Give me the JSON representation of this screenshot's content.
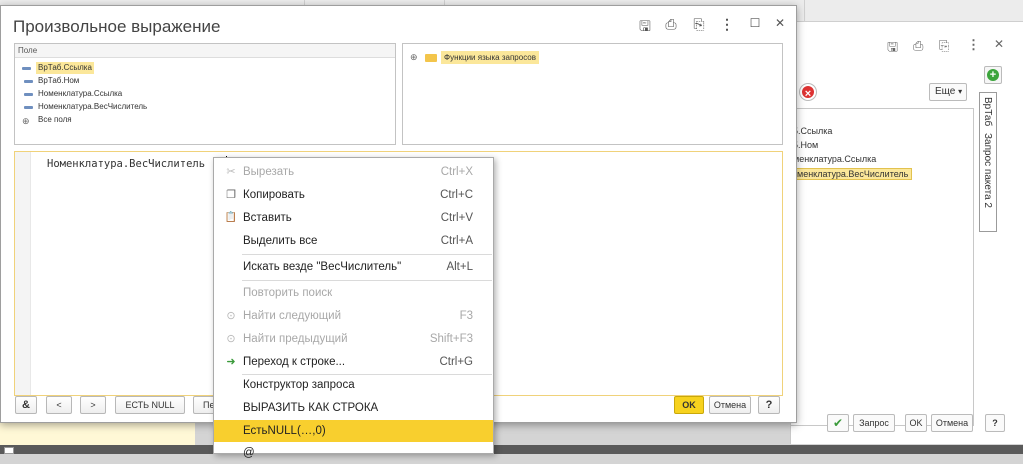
{
  "dialog": {
    "title": "Произвольное выражение",
    "fields_header": "Поле",
    "fields": [
      {
        "label": "ВрТаб.Ссылка",
        "selected": true
      },
      {
        "label": "ВрТаб.Ном",
        "selected": false
      },
      {
        "label": "Номенклатура.Ссылка",
        "selected": false
      },
      {
        "label": "Номенклатура.ВесЧислитель",
        "selected": false
      }
    ],
    "all_fields": "Все поля",
    "functions_label": "Функции языка запросов",
    "editor_text": "Номенклатура.ВесЧислитель",
    "buttons": {
      "amp": "&",
      "prev": "<",
      "next": ">",
      "isnull": "ЕСТЬ NULL",
      "more_partial": "Пе",
      "ok": "OK",
      "cancel": "Отмена",
      "help": "?"
    }
  },
  "context_menu": {
    "items": [
      {
        "icon": "cut-icon",
        "glyph": "✂",
        "label": "Вырезать",
        "shortcut": "Ctrl+X",
        "disabled": true,
        "highlighted": false
      },
      {
        "icon": "copy-icon",
        "glyph": "❐",
        "label": "Копировать",
        "shortcut": "Ctrl+C",
        "disabled": false,
        "highlighted": false
      },
      {
        "icon": "paste-icon",
        "glyph": "📋",
        "label": "Вставить",
        "shortcut": "Ctrl+V",
        "disabled": false,
        "highlighted": false
      },
      {
        "icon": "",
        "glyph": "",
        "label": "Выделить все",
        "shortcut": "Ctrl+A",
        "disabled": false,
        "highlighted": false
      },
      {
        "icon": "",
        "glyph": "",
        "label": "Искать везде \"ВесЧислитель\"",
        "shortcut": "Alt+L",
        "disabled": false,
        "highlighted": false
      },
      {
        "icon": "",
        "glyph": "",
        "label": "Повторить поиск",
        "shortcut": "",
        "disabled": true,
        "highlighted": false
      },
      {
        "icon": "find-next-icon",
        "glyph": "⊙",
        "label": "Найти следующий",
        "shortcut": "F3",
        "disabled": true,
        "highlighted": false
      },
      {
        "icon": "find-prev-icon",
        "glyph": "⊙",
        "label": "Найти предыдущий",
        "shortcut": "Shift+F3",
        "disabled": true,
        "highlighted": false
      },
      {
        "icon": "goto-line-icon",
        "glyph": "➜",
        "label": "Переход к строке...",
        "shortcut": "Ctrl+G",
        "disabled": false,
        "highlighted": false
      },
      {
        "icon": "",
        "glyph": "",
        "label": "Конструктор запроса",
        "shortcut": "",
        "disabled": false,
        "highlighted": false
      },
      {
        "icon": "",
        "glyph": "",
        "label": "ВЫРАЗИТЬ КАК СТРОКА",
        "shortcut": "",
        "disabled": false,
        "highlighted": false
      },
      {
        "icon": "",
        "glyph": "",
        "label": "ЕстьNULL(…,0)",
        "shortcut": "",
        "disabled": false,
        "highlighted": true
      },
      {
        "icon": "",
        "glyph": "",
        "label": "@",
        "shortcut": "",
        "disabled": false,
        "highlighted": false
      }
    ]
  },
  "background_window": {
    "more_button": "Еще",
    "list": [
      "5.Ссылка",
      "5.Ном",
      "менклатура.Ссылка",
      "менклатура.ВесЧислитель"
    ],
    "vertical_tabs": [
      "ВрТаб",
      "Запрос пакета 2"
    ],
    "buttons": {
      "query": "Запрос",
      "ok": "OK",
      "cancel": "Отмена",
      "help": "?"
    }
  },
  "colors": {
    "highlight": "#f8cf2e",
    "selection": "#fbe79a",
    "ok_button": "#f7d21e"
  }
}
